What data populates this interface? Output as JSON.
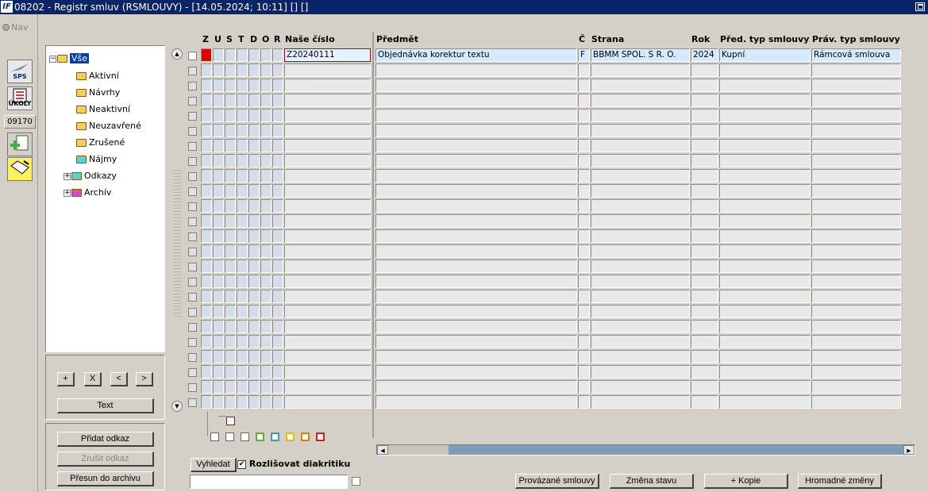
{
  "window": {
    "title": "08202 - Registr smluv (RSMLOUVY) - [14.05.2024; 10:11] [] []",
    "logo_text": "IF"
  },
  "nav": {
    "label": "Nav"
  },
  "toolbar": {
    "sps_label": "SPS",
    "ukoly_label": "ÚKOLY",
    "counter": "09170"
  },
  "tree": {
    "root": "Vše",
    "items": [
      {
        "label": "Aktivní",
        "color": "#f0d060"
      },
      {
        "label": "Návrhy",
        "color": "#f0d060"
      },
      {
        "label": "Neaktivní",
        "color": "#f0d060"
      },
      {
        "label": "Neuzavřené",
        "color": "#f0d060"
      },
      {
        "label": "Zrušené",
        "color": "#f0d060"
      },
      {
        "label": "Nájmy",
        "color": "#5fcfd0"
      },
      {
        "label": "Odkazy",
        "color": "#5fcfd0",
        "expandable": true
      },
      {
        "label": "Archív",
        "color": "#d050c0",
        "expandable": true
      }
    ]
  },
  "tree_buttons": {
    "add": "+",
    "remove": "X",
    "prev": "<",
    "next": ">",
    "text": "Text"
  },
  "link_buttons": {
    "add_link": "Přidat odkaz",
    "cancel_link": "Zrušit odkaz",
    "move_archive": "Přesun do archivu"
  },
  "search": {
    "button": "Vyhledat",
    "diacritics_label": "Rozlišovat diakritiku",
    "diacritics_checked": true,
    "value": ""
  },
  "table": {
    "flag_headers": [
      "Z",
      "U",
      "S",
      "T",
      "D",
      "O",
      "R"
    ],
    "headers": {
      "nase_cislo": "Naše číslo",
      "predmet": "Předmět",
      "c": "Č",
      "strana": "Strana",
      "rok": "Rok",
      "pred_typ": "Před. typ smlouvy",
      "prav_typ": "Práv. typ smlouvy"
    },
    "rows": [
      {
        "nase_cislo": "Z20240111",
        "predmet": "Objednávka korektur textu",
        "c": "F",
        "strana": "BBMM SPOL. S R. O.",
        "rok": "2024",
        "pred_typ": "Kupní",
        "prav_typ": "Rámcová smlouva",
        "z_color": "#e00000"
      }
    ],
    "empty_rows": 23
  },
  "bottom_buttons": {
    "linked": "Provázané smlouvy",
    "change_state": "Změna stavu",
    "copy": "+ Kopie",
    "bulk": "Hromadné změny"
  },
  "legend_colors": [
    "#ffffff",
    "#ffffff",
    "#ffffff",
    "#60b040",
    "#40a0a0",
    "#e0c000",
    "#e08000",
    "#d02020"
  ]
}
